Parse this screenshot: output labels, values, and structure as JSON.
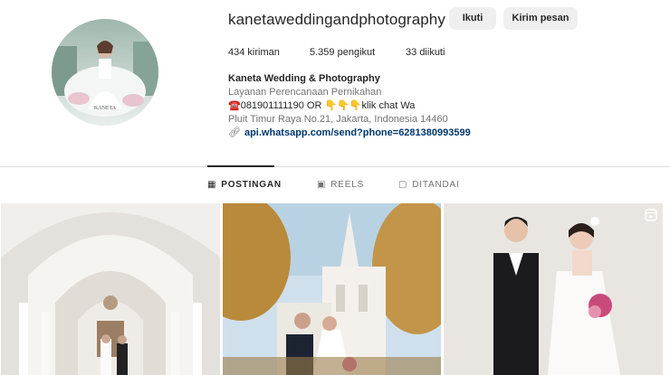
{
  "profile": {
    "username": "kanetaweddingandphotography",
    "follow_label": "Ikuti",
    "message_label": "Kirim pesan",
    "avatar_logo_text": "KANETA"
  },
  "stats": {
    "posts": "434",
    "posts_label": "kiriman",
    "followers": "5.359",
    "followers_label": "pengikut",
    "following": "33",
    "following_label": "diikuti"
  },
  "bio": {
    "name": "Kaneta Wedding & Photography",
    "category": "Layanan Perencanaan Pernikahan",
    "phone_line": "☎️081901111190 OR 👇👇👇klik chat Wa",
    "address": "Pluit Timur Raya No.21, Jakarta, Indonesia 14460",
    "link": "api.whatsapp.com/send?phone=6281380993599"
  },
  "tabs": [
    {
      "label": "POSTINGAN",
      "icon": "grid-icon",
      "active": true
    },
    {
      "label": "REELS",
      "icon": "reels-icon",
      "active": false
    },
    {
      "label": "DITANDAI",
      "icon": "tagged-icon",
      "active": false
    }
  ],
  "posts": [
    {
      "description_icon": "photo"
    },
    {
      "description_icon": "photo"
    },
    {
      "description_icon": "reel-icon"
    }
  ]
}
